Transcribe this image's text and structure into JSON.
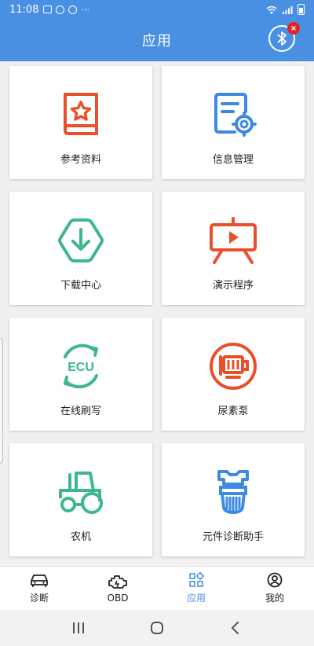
{
  "status_bar": {
    "time": "11:08",
    "dots": "···"
  },
  "header": {
    "title": "应用",
    "bluetooth_badge": "×"
  },
  "apps": [
    {
      "label": "参考资料",
      "icon": "book-star-icon",
      "color": "#e8502a"
    },
    {
      "label": "信息管理",
      "icon": "document-gear-icon",
      "color": "#3d8be0"
    },
    {
      "label": "下载中心",
      "icon": "hexagon-download-icon",
      "color": "#3cb88a"
    },
    {
      "label": "演示程序",
      "icon": "presentation-play-icon",
      "color": "#e8502a"
    },
    {
      "label": "在线刷写",
      "icon": "ecu-refresh-icon",
      "color": "#3cb88a",
      "icon_text": "ECU"
    },
    {
      "label": "尿素泵",
      "icon": "pump-icon",
      "color": "#e8502a"
    },
    {
      "label": "农机",
      "icon": "tractor-icon",
      "color": "#3cb88a"
    },
    {
      "label": "元件诊断助手",
      "icon": "component-icon",
      "color": "#3d8be0"
    }
  ],
  "tabs": [
    {
      "label": "诊断",
      "icon": "car-icon"
    },
    {
      "label": "OBD",
      "icon": "engine-icon"
    },
    {
      "label": "应用",
      "icon": "apps-icon",
      "active": true
    },
    {
      "label": "我的",
      "icon": "user-icon"
    }
  ],
  "colors": {
    "primary": "#4a90e2",
    "red": "#e8502a",
    "green": "#3cb88a",
    "blue": "#3d8be0"
  }
}
